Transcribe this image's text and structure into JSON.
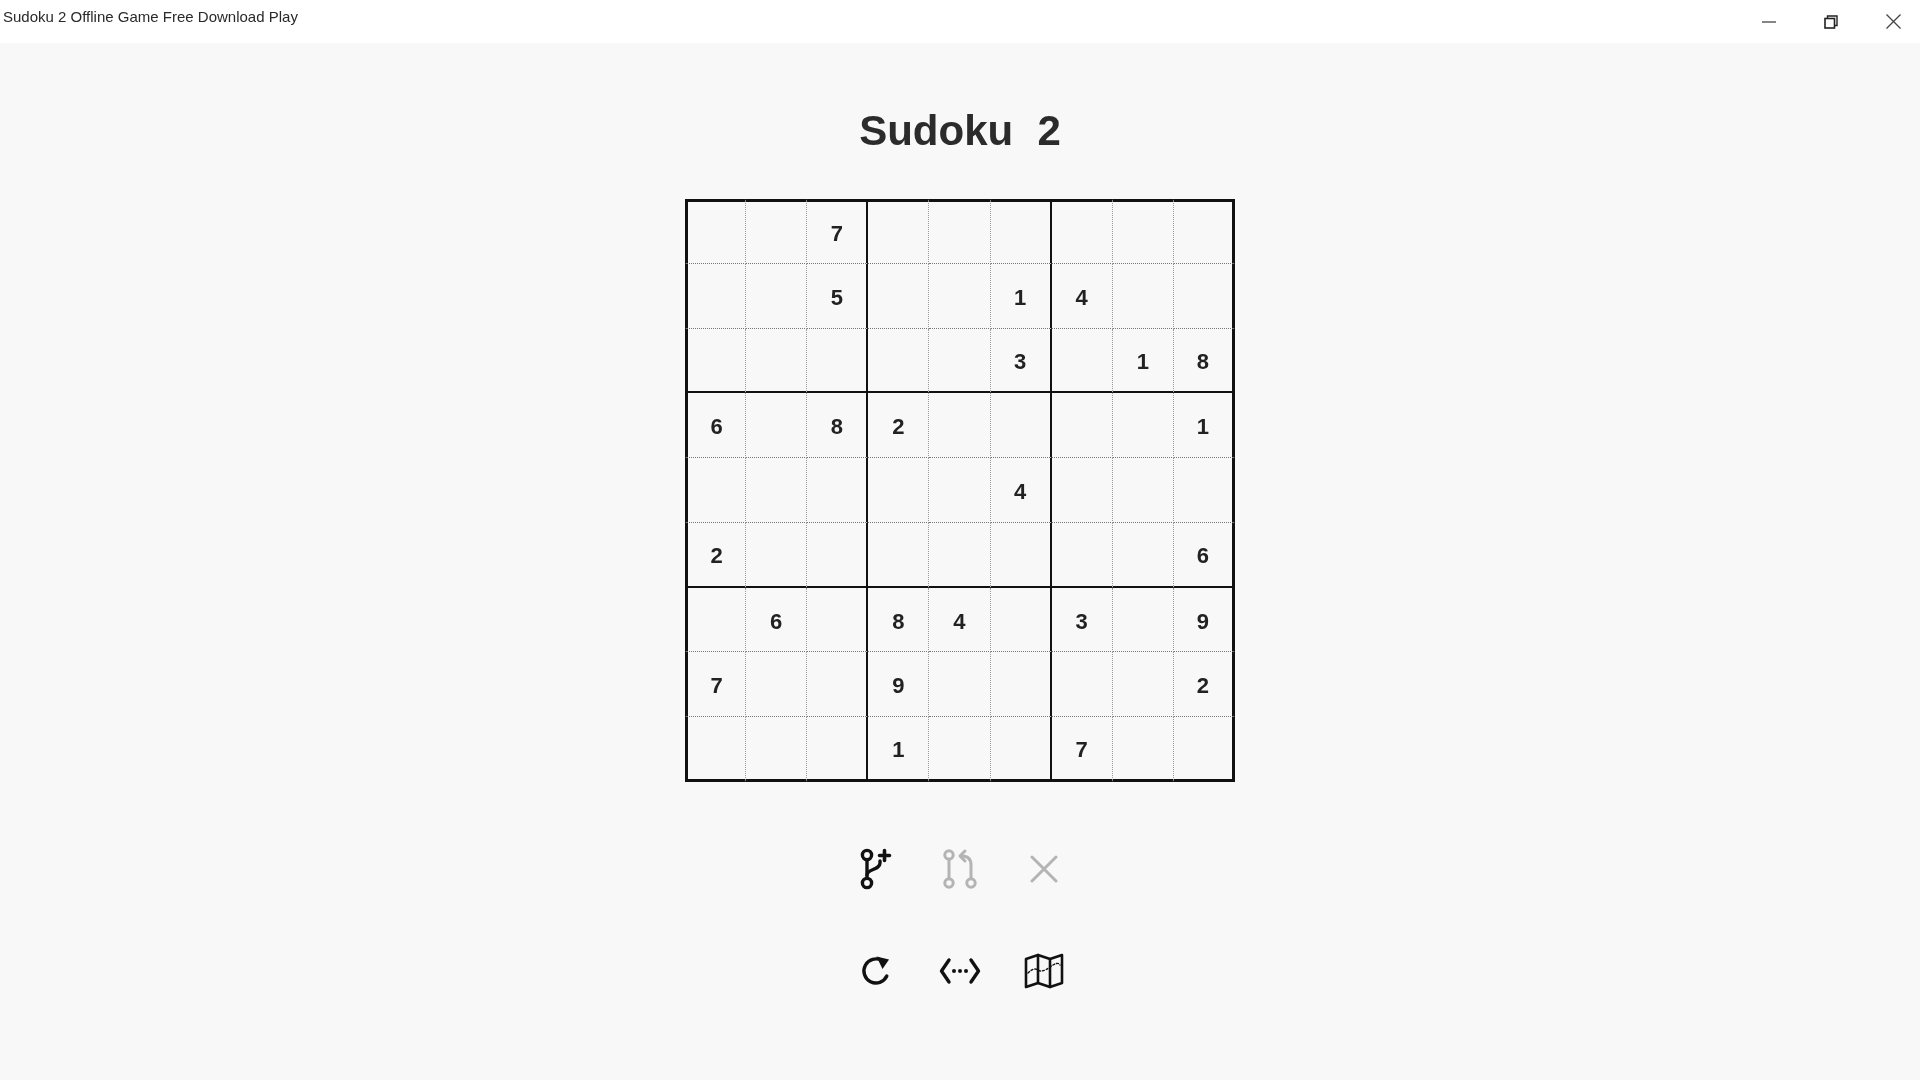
{
  "window": {
    "title": "Sudoku 2 Offline Game Free Download Play"
  },
  "heading": "Sudoku 2",
  "board": {
    "rows": [
      [
        null,
        null,
        "7",
        null,
        null,
        null,
        null,
        null,
        null
      ],
      [
        null,
        null,
        "5",
        null,
        null,
        "1",
        "4",
        null,
        null
      ],
      [
        null,
        null,
        null,
        null,
        null,
        "3",
        null,
        "1",
        "8"
      ],
      [
        "6",
        null,
        "8",
        "2",
        null,
        null,
        null,
        null,
        "1"
      ],
      [
        null,
        null,
        null,
        null,
        null,
        "4",
        null,
        null,
        null
      ],
      [
        "2",
        null,
        null,
        null,
        null,
        null,
        null,
        null,
        "6"
      ],
      [
        null,
        "6",
        null,
        "8",
        "4",
        null,
        "3",
        null,
        "9"
      ],
      [
        "7",
        null,
        null,
        "9",
        null,
        null,
        null,
        null,
        "2"
      ],
      [
        null,
        null,
        null,
        "1",
        null,
        null,
        "7",
        null,
        null
      ]
    ]
  },
  "edit_tools": [
    {
      "disabled": false
    },
    {
      "disabled": true
    },
    {
      "disabled": true
    }
  ],
  "game_tools": [
    {
      "disabled": false
    },
    {
      "disabled": false
    },
    {
      "disabled": false
    }
  ]
}
